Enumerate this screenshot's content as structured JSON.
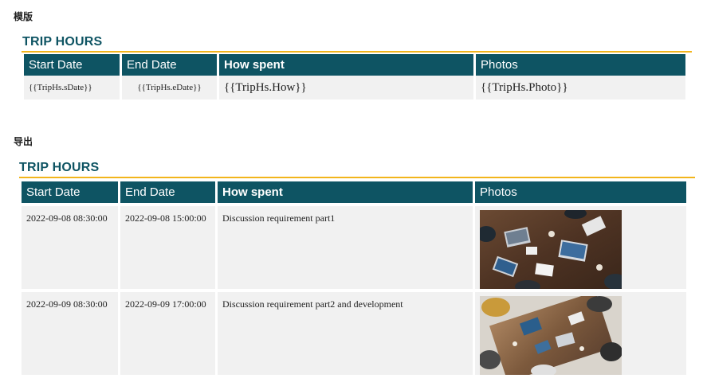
{
  "template_section": {
    "label": "模版",
    "title": "TRIP HOURS",
    "headers": [
      "Start Date",
      "End Date",
      "How spent",
      "Photos"
    ],
    "row": [
      "{{TripHs.sDate}}",
      "{{TripHs.eDate}}",
      "{{TripHs.How}}",
      "{{TripHs.Photo}}"
    ]
  },
  "export_section": {
    "label": "导出",
    "title": "TRIP HOURS",
    "headers": [
      "Start Date",
      "End Date",
      "How spent",
      "Photos"
    ],
    "rows": [
      {
        "start": "2022-09-08 08:30:00",
        "end": "2022-09-08 15:00:00",
        "how": "Discussion requirement part1",
        "photo": "meeting-photo-1"
      },
      {
        "start": "2022-09-09 08:30:00",
        "end": "2022-09-09 17:00:00",
        "how": "Discussion requirement part2 and development",
        "photo": "meeting-photo-2"
      }
    ]
  },
  "colors": {
    "header_bg": "#0e5463",
    "title": "#0e5463",
    "rule": "#f2b51c",
    "cell_bg": "#f1f1f1"
  }
}
